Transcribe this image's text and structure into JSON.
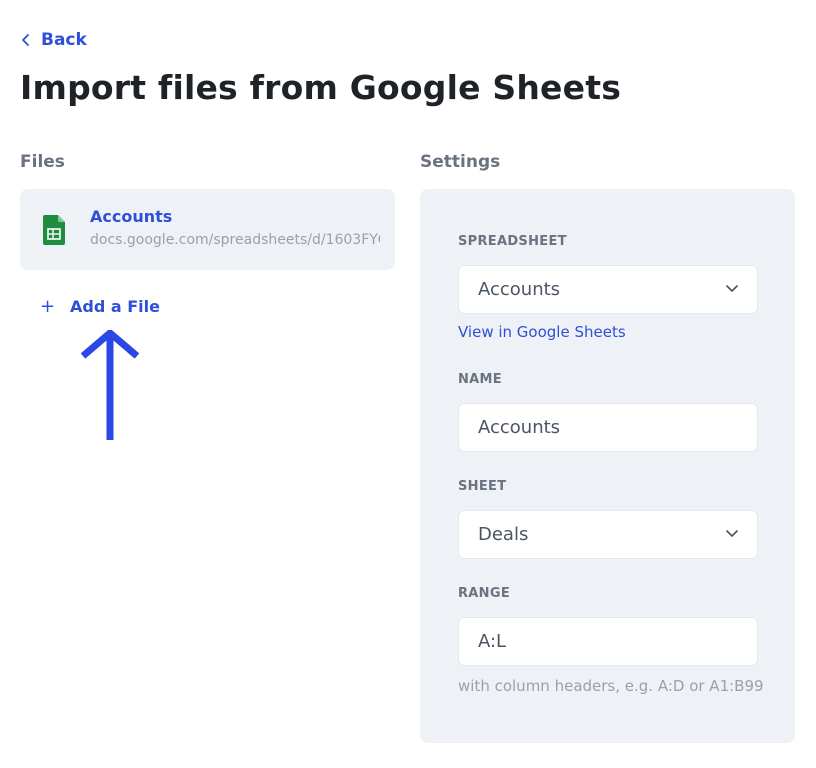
{
  "nav": {
    "back_label": "Back"
  },
  "page": {
    "title": "Import files from Google Sheets"
  },
  "files_section": {
    "label": "Files",
    "items": [
      {
        "name": "Accounts",
        "url": "docs.google.com/spreadsheets/d/1603FYG7...",
        "icon": "google-sheets-icon"
      }
    ],
    "add_label": "Add a File",
    "add_icon": "plus-icon"
  },
  "annotation": {
    "icon": "arrow-up-icon",
    "color": "#2b47e6"
  },
  "settings": {
    "label": "Settings",
    "spreadsheet": {
      "label": "SPREADSHEET",
      "value": "Accounts",
      "link": "View in Google Sheets"
    },
    "name": {
      "label": "NAME",
      "value": "Accounts"
    },
    "sheet": {
      "label": "SHEET",
      "value": "Deals"
    },
    "range": {
      "label": "RANGE",
      "value": "A:L",
      "hint": "with column headers, e.g. A:D or A1:B99"
    }
  },
  "colors": {
    "accent": "#2f4fd6",
    "sheets_green": "#1e8e3e",
    "panel_bg": "#eef1f5"
  }
}
